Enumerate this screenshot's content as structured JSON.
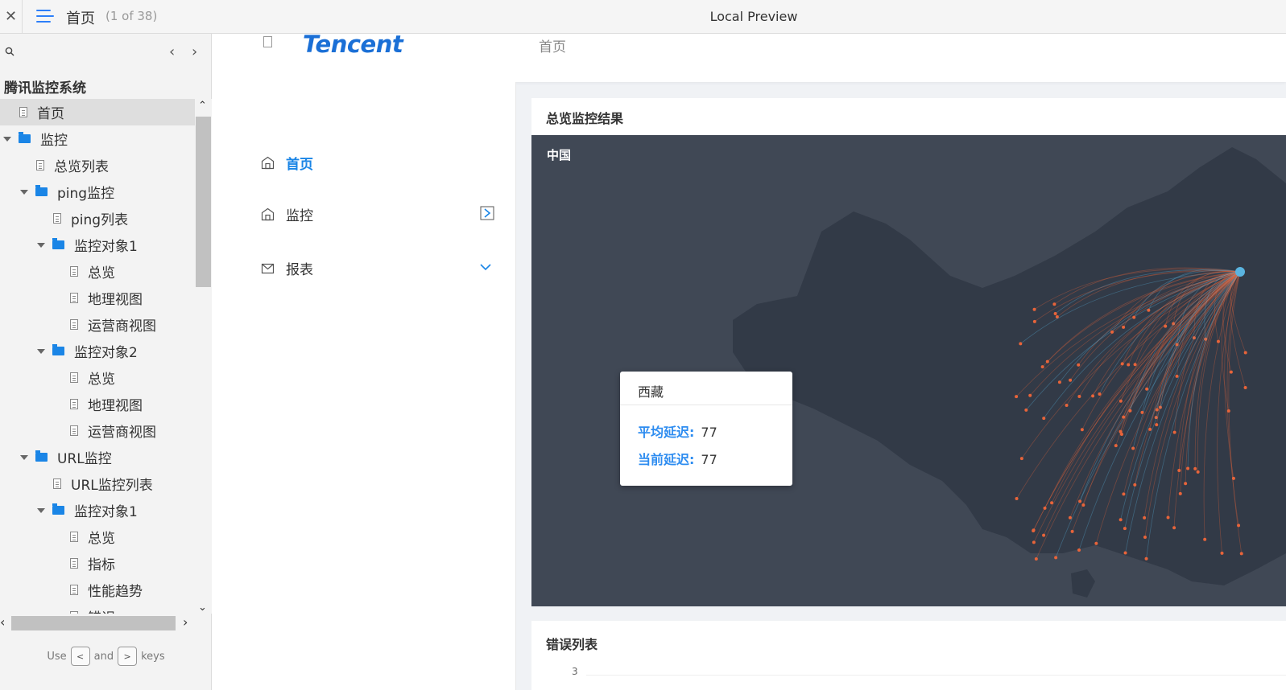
{
  "window": {
    "close_glyph": "✕",
    "page_title": "首页",
    "page_count": "(1 of 38)",
    "preview_title": "Local Preview"
  },
  "sidebar": {
    "prev_glyph": "‹",
    "next_glyph": "›",
    "tree_title": "腾讯监控系统",
    "items": [
      {
        "label": "首页",
        "type": "doc",
        "level": 1
      },
      {
        "label": "监控",
        "type": "folder",
        "level": 0
      },
      {
        "label": "总览列表",
        "type": "doc",
        "level": 2
      },
      {
        "label": "ping监控",
        "type": "folder",
        "level": 1
      },
      {
        "label": "ping列表",
        "type": "doc",
        "level": 3
      },
      {
        "label": "监控对象1",
        "type": "folder",
        "level": 2
      },
      {
        "label": "总览",
        "type": "doc",
        "level": 4
      },
      {
        "label": "地理视图",
        "type": "doc",
        "level": 4
      },
      {
        "label": "运营商视图",
        "type": "doc",
        "level": 4
      },
      {
        "label": "监控对象2",
        "type": "folder",
        "level": 2
      },
      {
        "label": "总览",
        "type": "doc",
        "level": 4
      },
      {
        "label": "地理视图",
        "type": "doc",
        "level": 4
      },
      {
        "label": "运营商视图",
        "type": "doc",
        "level": 4
      },
      {
        "label": "URL监控",
        "type": "folder",
        "level": 1
      },
      {
        "label": "URL监控列表",
        "type": "doc",
        "level": 3
      },
      {
        "label": "监控对象1",
        "type": "folder",
        "level": 2
      },
      {
        "label": "总览",
        "type": "doc",
        "level": 4
      },
      {
        "label": "指标",
        "type": "doc",
        "level": 4
      },
      {
        "label": "性能趋势",
        "type": "doc",
        "level": 4
      },
      {
        "label": "错误",
        "type": "doc",
        "level": 4
      }
    ],
    "hint": {
      "use": "Use",
      "key_prev": "<",
      "and": "and",
      "key_next": ">",
      "keys": "keys"
    }
  },
  "page": {
    "brand": "Tencent",
    "header_crumb": "首页",
    "menu": [
      {
        "label": "首页",
        "active": true,
        "icon": "home-icon"
      },
      {
        "label": "监控",
        "active": false,
        "icon": "home-icon"
      },
      {
        "label": "报表",
        "active": false,
        "icon": "mail-icon"
      }
    ],
    "map_card": {
      "title": "总览监控结果",
      "map_label": "中国",
      "tooltip": {
        "title": "西藏",
        "avg_label": "平均延迟:",
        "avg_value": "77",
        "cur_label": "当前延迟:",
        "cur_value": "77"
      }
    },
    "errors_card": {
      "title": "错误列表",
      "first_tick": "3"
    }
  },
  "colors": {
    "accent": "#1a85e6",
    "map_bg": "#404855",
    "land": "#323a47",
    "flow": "#e8643a",
    "hub": "#5ab4e0"
  }
}
